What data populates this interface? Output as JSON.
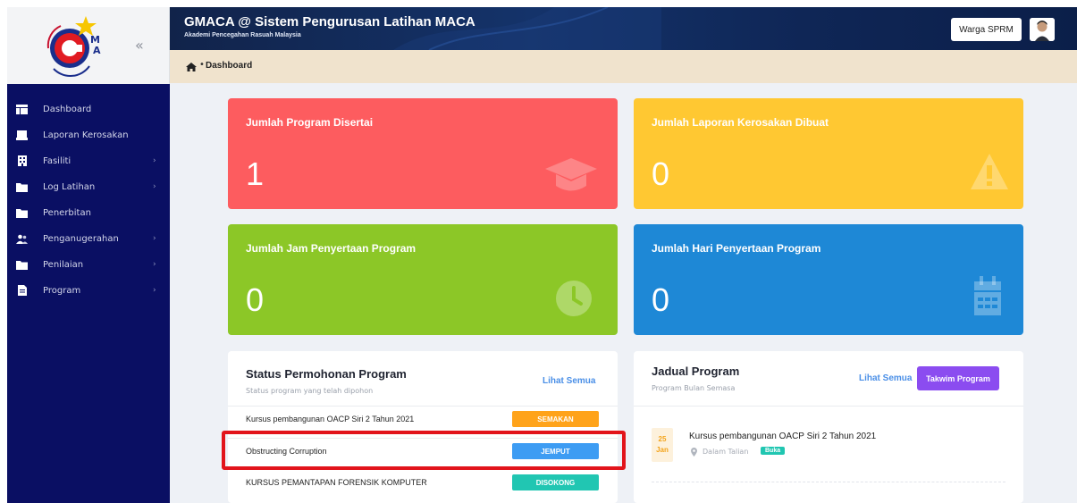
{
  "header": {
    "title": "GMACA @ Sistem Pengurusan Latihan MACA",
    "subtitle": "Akademi Pencegahan Rasuah Malaysia",
    "role_button": "Warga SPRM"
  },
  "sidebar": {
    "collapse_label": "«",
    "items": [
      {
        "label": "Dashboard",
        "icon": "dashboard-icon",
        "has_submenu": false
      },
      {
        "label": "Laporan Kerosakan",
        "icon": "report-icon",
        "has_submenu": false
      },
      {
        "label": "Fasiliti",
        "icon": "building-icon",
        "has_submenu": true
      },
      {
        "label": "Log Latihan",
        "icon": "folder-icon",
        "has_submenu": true
      },
      {
        "label": "Penerbitan",
        "icon": "folder-icon",
        "has_submenu": false
      },
      {
        "label": "Penganugerahan",
        "icon": "users-icon",
        "has_submenu": true
      },
      {
        "label": "Penilaian",
        "icon": "folder-icon",
        "has_submenu": true
      },
      {
        "label": "Program",
        "icon": "document-icon",
        "has_submenu": true
      }
    ],
    "chevron": "›"
  },
  "breadcrumb": {
    "separator": "•",
    "current": "Dashboard"
  },
  "stats": [
    {
      "title": "Jumlah Program Disertai",
      "value": "1",
      "color": "#fd5c5f",
      "icon": "graduation-cap-icon"
    },
    {
      "title": "Jumlah Laporan Kerosakan Dibuat",
      "value": "0",
      "color": "#ffc832",
      "icon": "warning-icon"
    },
    {
      "title": "Jumlah Jam Penyertaan Program",
      "value": "0",
      "color": "#8cc727",
      "icon": "clock-icon"
    },
    {
      "title": "Jumlah Hari Penyertaan Program",
      "value": "0",
      "color": "#1e88d6",
      "icon": "calendar-icon"
    }
  ],
  "status_panel": {
    "title": "Status Permohonan Program",
    "subtitle": "Status program yang telah dipohon",
    "link": "Lihat Semua",
    "rows": [
      {
        "program": "Kursus pembangunan OACP Siri 2 Tahun 2021",
        "status": "SEMAKAN",
        "color": "#ffa31a"
      },
      {
        "program": "Obstructing Corruption",
        "status": "JEMPUT",
        "color": "#3d9cf3"
      },
      {
        "program": "KURSUS PEMANTAPAN FORENSIK KOMPUTER",
        "status": "DISOKONG",
        "color": "#21c6b2"
      }
    ]
  },
  "schedule_panel": {
    "title": "Jadual Program",
    "subtitle": "Program Bulan Semasa",
    "link": "Lihat Semua",
    "calendar_button": "Takwim Program",
    "items": [
      {
        "day": "25",
        "month": "Jan",
        "title": "Kursus pembangunan OACP Siri 2 Tahun 2021",
        "location": "Dalam Talian",
        "badge": "Buka"
      }
    ]
  }
}
